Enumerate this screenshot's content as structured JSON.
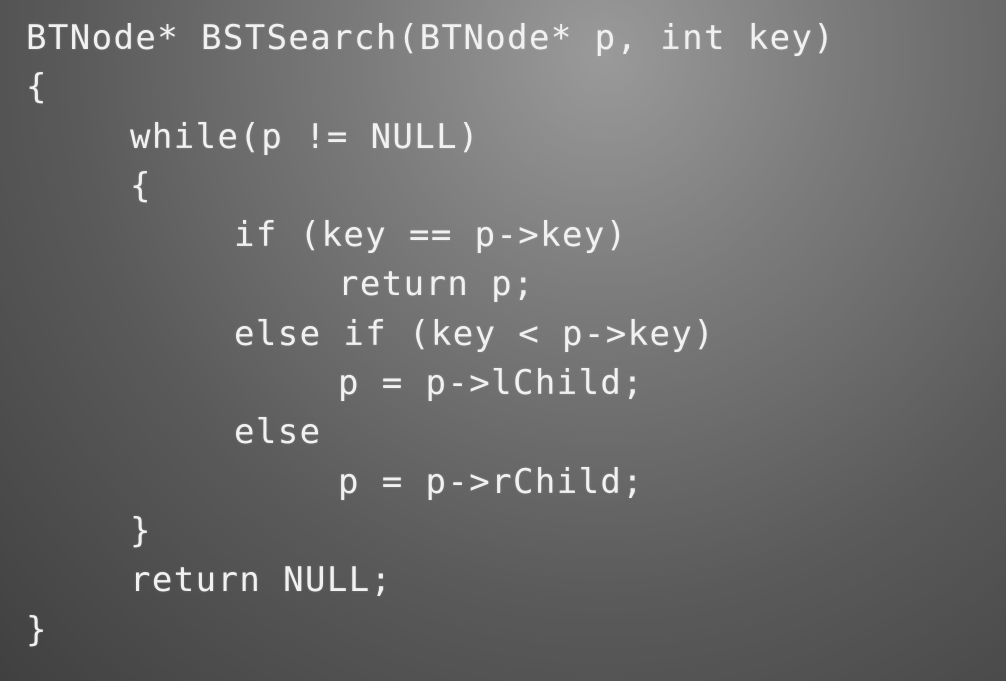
{
  "code_lines": [
    {
      "text": "BTNode* BSTSearch(BTNode* p, int key)",
      "indent": 0
    },
    {
      "text": "{",
      "indent": 0
    },
    {
      "text": "while(p != NULL)",
      "indent": 1
    },
    {
      "text": "{",
      "indent": 1
    },
    {
      "text": "if (key == p->key)",
      "indent": 2
    },
    {
      "text": "return p;",
      "indent": 3
    },
    {
      "text": "else if (key < p->key)",
      "indent": 2
    },
    {
      "text": "p = p->lChild;",
      "indent": 3
    },
    {
      "text": "else",
      "indent": 2
    },
    {
      "text": "p = p->rChild;",
      "indent": 3
    },
    {
      "text": "}",
      "indent": 1
    },
    {
      "text": "return NULL;",
      "indent": 1
    },
    {
      "text": "}",
      "indent": 0
    }
  ],
  "colors": {
    "text": "#f1f1f1",
    "background_light": "#9a9a9a",
    "background_dark": "#404040"
  }
}
